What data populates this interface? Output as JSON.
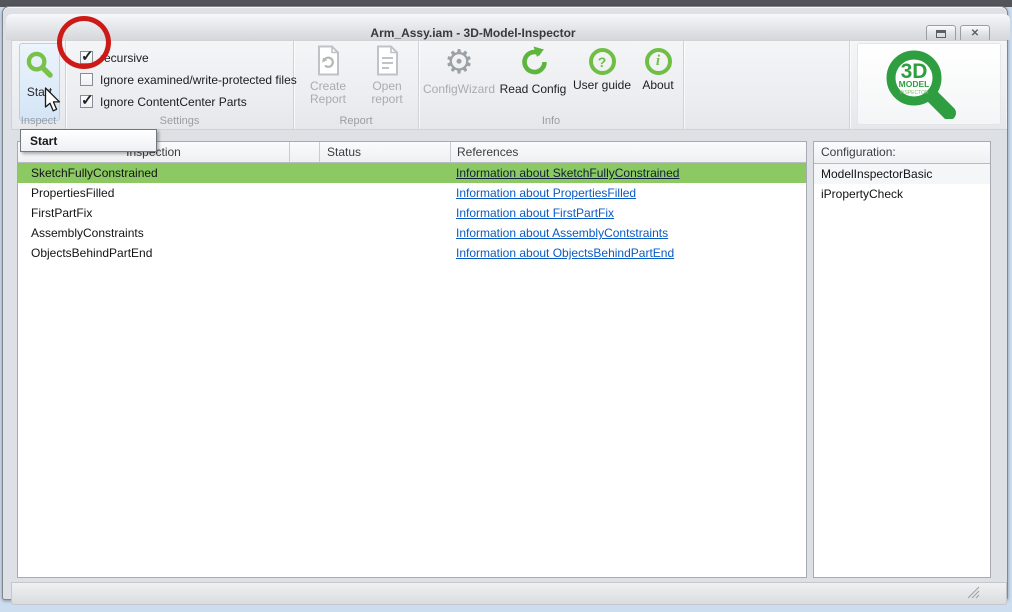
{
  "window": {
    "title": "Arm_Assy.iam - 3D-Model-Inspector",
    "close_glyph": "✕"
  },
  "ribbon": {
    "inspect": {
      "group_label": "Inspect",
      "start_label": "Start"
    },
    "settings": {
      "group_label": "Settings",
      "checkboxes": [
        {
          "label": "recursive",
          "checked": true
        },
        {
          "label": "Ignore examined/write-protected files",
          "checked": false
        },
        {
          "label": "Ignore ContentCenter Parts",
          "checked": true
        }
      ]
    },
    "report": {
      "group_label": "Report",
      "create_label": "Create Report",
      "open_label": "Open report"
    },
    "info": {
      "group_label": "Info",
      "configwizard_label": "ConfigWizard",
      "readconfig_label": "Read Config",
      "userguide_label": "User guide",
      "about_label": "About"
    },
    "logo": {
      "l1": "3D",
      "l2": "MODEL",
      "l3": "INSPECTOR"
    }
  },
  "tooltip": {
    "text": "Start"
  },
  "grid": {
    "columns": {
      "name": "Inspection",
      "spacer": "",
      "status": "Status",
      "references": "References"
    },
    "rows": [
      {
        "name": "SketchFullyConstrained",
        "status": "",
        "reference": "Information about SketchFullyConstrained",
        "selected": true
      },
      {
        "name": "PropertiesFilled",
        "status": "",
        "reference": "Information about PropertiesFilled",
        "selected": false
      },
      {
        "name": "FirstPartFix",
        "status": "",
        "reference": "Information about FirstPartFix",
        "selected": false
      },
      {
        "name": "AssemblyConstraints",
        "status": "",
        "reference": "Information about AssemblyContstraints",
        "selected": false
      },
      {
        "name": "ObjectsBehindPartEnd",
        "status": "",
        "reference": "Information about ObjectsBehindPartEnd",
        "selected": false
      }
    ]
  },
  "config_panel": {
    "header": "Configuration:",
    "items": [
      "ModelInspectorBasic",
      "iPropertyCheck"
    ]
  },
  "icons": {
    "check_glyph": "✓",
    "gear_glyph": "⚙",
    "question_glyph": "?",
    "info_glyph": "i"
  },
  "colors": {
    "accent_green": "#6fbf44",
    "logo_green": "#2f9e41",
    "selection_green": "#8cc963",
    "link_blue": "#0a5bc4",
    "annotation_red": "#ce1a17"
  }
}
